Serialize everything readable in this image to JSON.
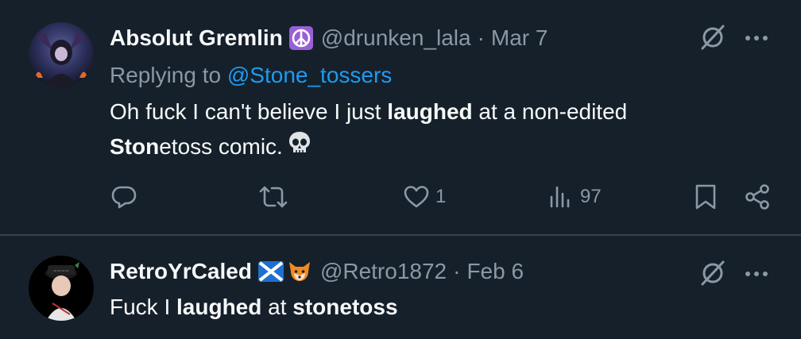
{
  "tweets": [
    {
      "display_name": "Absolut Gremlin",
      "badge_icon": "peace-sign-icon",
      "handle": "@drunken_lala",
      "separator": "·",
      "date": "Mar 7",
      "reply_prefix": "Replying to",
      "reply_to": "@Stone_tossers",
      "body": {
        "line1_a": "Oh fuck I can't believe I just ",
        "line1_b": "laughed",
        "line1_c": " at a non-edited",
        "line2_a": "Ston",
        "line2_b": "etoss comic.",
        "emoji": "skull-icon"
      },
      "actions": {
        "reply_count": "",
        "retweet_count": "",
        "like_count": "1",
        "views_count": "97"
      }
    },
    {
      "display_name": "RetroYrCaled",
      "badge_icons": [
        "scotland-flag-icon",
        "fox-face-icon"
      ],
      "handle": "@Retro1872",
      "separator": "·",
      "date": "Feb 6",
      "body": {
        "a": "Fuck I ",
        "b": "laughed",
        "c": " at ",
        "d": "stonetoss"
      }
    }
  ],
  "colors": {
    "background": "#15202b",
    "primary_text": "#f7f9f9",
    "secondary_text": "#8b98a5",
    "link": "#1d9bf0",
    "divider": "#38444d"
  }
}
